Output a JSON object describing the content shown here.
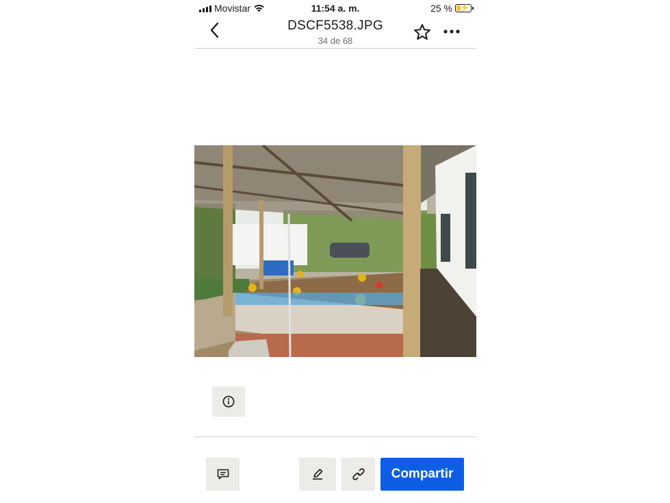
{
  "status_bar": {
    "carrier": "Movistar",
    "time": "11:54 a. m.",
    "battery": "25 %"
  },
  "header": {
    "title": "DSCF5538.JPG",
    "position": "34 de 68"
  },
  "icons": {
    "back": "chevron-left-icon",
    "favorite": "star-icon",
    "more": "more-horizontal-icon",
    "info": "info-icon",
    "comment": "comment-icon",
    "edit": "pencil-icon",
    "link": "link-icon"
  },
  "toolbar": {
    "share_label": "Compartir"
  },
  "colors": {
    "accent": "#0d5ee5",
    "button_bg": "#ecebe8",
    "subtle_text": "#6b6b6b"
  }
}
